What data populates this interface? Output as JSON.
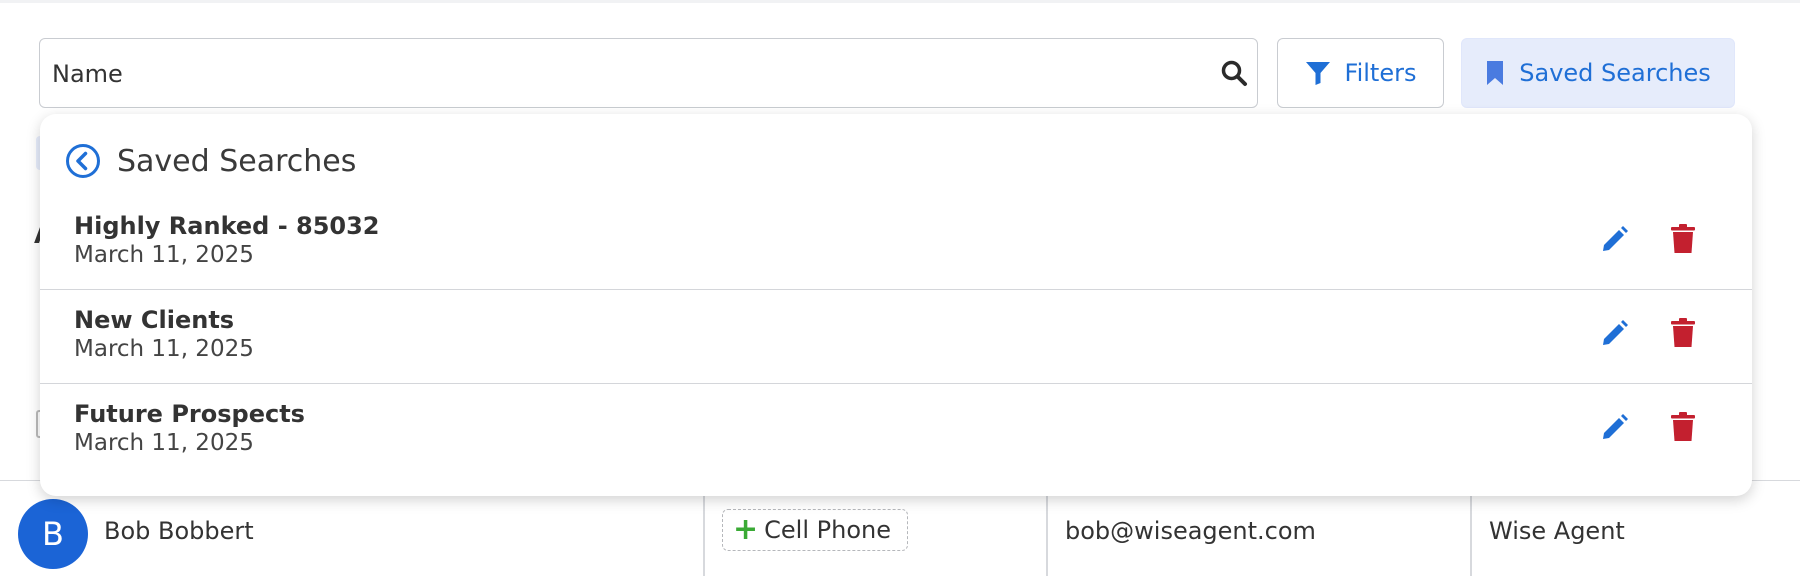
{
  "search": {
    "placeholder": "Name",
    "value": ""
  },
  "toolbar": {
    "filters_label": "Filters",
    "saved_searches_label": "Saved Searches"
  },
  "dropdown": {
    "title": "Saved Searches",
    "items": [
      {
        "name": "Highly Ranked - 85032",
        "date": "March 11, 2025"
      },
      {
        "name": "New Clients",
        "date": "March 11, 2025"
      },
      {
        "name": "Future Prospects",
        "date": "March 11, 2025"
      }
    ]
  },
  "background": {
    "section_letter": "A"
  },
  "contact_row": {
    "avatar_initial": "B",
    "name": "Bob Bobbert",
    "phone_chip": "Cell Phone",
    "email": "bob@wiseagent.com",
    "source": "Wise Agent"
  },
  "colors": {
    "accent": "#1f6fd6",
    "saved_button_bg": "#e6ecfb",
    "delete_red": "#c3202f",
    "add_green": "#3aaa35",
    "avatar_blue": "#1b64d6"
  },
  "icons": {
    "search": "search-icon",
    "filters": "filter-icon",
    "saved": "bookmark-icon",
    "back": "chevron-left-circle-icon",
    "edit": "pencil-icon",
    "delete": "trash-icon",
    "add": "plus-icon"
  }
}
